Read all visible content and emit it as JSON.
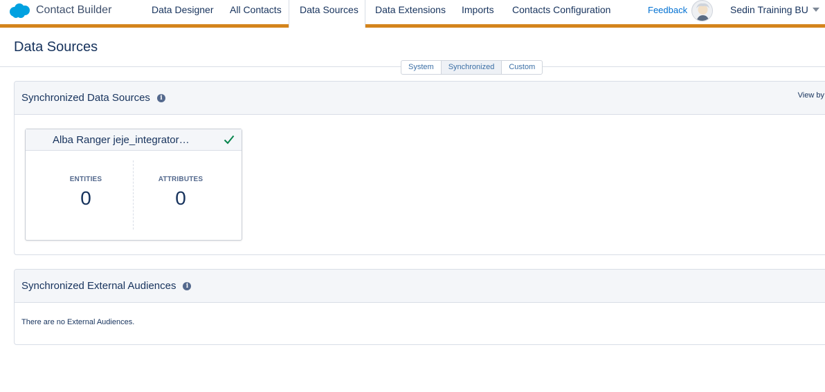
{
  "app": {
    "title": "Contact Builder",
    "brand_color": "#00a1e0",
    "accent_bar_color": "#d4841c"
  },
  "nav": {
    "items": [
      {
        "label": "Data Designer"
      },
      {
        "label": "All Contacts"
      },
      {
        "label": "Data Sources",
        "active": true
      },
      {
        "label": "Data Extensions"
      },
      {
        "label": "Imports"
      },
      {
        "label": "Contacts Configuration"
      }
    ],
    "feedback": "Feedback",
    "business_unit": "Sedin Training BU"
  },
  "page": {
    "title": "Data Sources"
  },
  "source_toggle": {
    "options": [
      "System",
      "Synchronized",
      "Custom"
    ],
    "selected": "Synchronized"
  },
  "synced_sources": {
    "title": "Synchronized Data Sources",
    "view_by": "View by",
    "cards": [
      {
        "name": "Alba Ranger jeje_integrator…",
        "status_icon": "check-icon",
        "status_color": "#04844b",
        "entities_label": "ENTITIES",
        "entities_value": "0",
        "attributes_label": "ATTRIBUTES",
        "attributes_value": "0"
      }
    ]
  },
  "external_audiences": {
    "title": "Synchronized External Audiences",
    "empty_message": "There are no External Audiences."
  }
}
